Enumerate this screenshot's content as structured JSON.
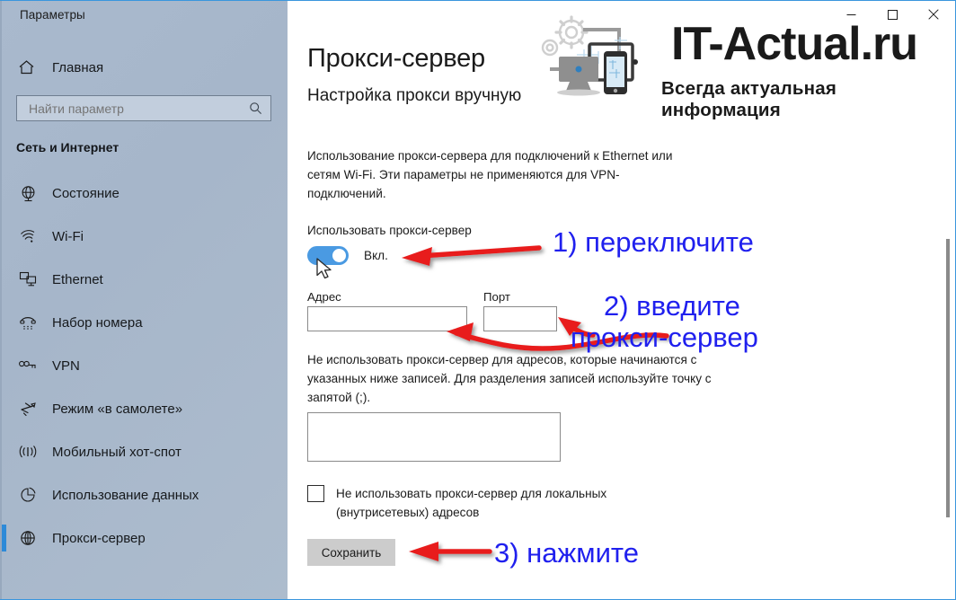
{
  "window": {
    "title": "Параметры",
    "controls": [
      {
        "name": "minimize",
        "glyph": "minimize-icon"
      },
      {
        "name": "maximize",
        "glyph": "maximize-icon"
      },
      {
        "name": "close",
        "glyph": "close-icon"
      }
    ],
    "accent_color": "#0078d7",
    "border_color": "#3a96dd"
  },
  "sidebar": {
    "background_color": "#a8b8cc",
    "home": {
      "label": "Главная",
      "icon": "home-icon"
    },
    "search": {
      "placeholder": "Найти параметр",
      "value": "",
      "icon": "search-icon"
    },
    "section_header": "Сеть и Интернет",
    "items": [
      {
        "label": "Состояние",
        "icon": "globe-status-icon",
        "selected": false
      },
      {
        "label": "Wi-Fi",
        "icon": "wifi-icon",
        "selected": false
      },
      {
        "label": "Ethernet",
        "icon": "ethernet-icon",
        "selected": false
      },
      {
        "label": "Набор номера",
        "icon": "dialup-phone-icon",
        "selected": false
      },
      {
        "label": "VPN",
        "icon": "vpn-key-icon",
        "selected": false
      },
      {
        "label": "Режим «в самолете»",
        "icon": "airplane-icon",
        "selected": false
      },
      {
        "label": "Мобильный хот-спот",
        "icon": "hotspot-icon",
        "selected": false
      },
      {
        "label": "Использование данных",
        "icon": "data-usage-pie-icon",
        "selected": false
      },
      {
        "label": "Прокси-сервер",
        "icon": "globe-proxy-icon",
        "selected": true
      }
    ]
  },
  "main": {
    "page_title": "Прокси-сервер",
    "subsection_title": "Настройка прокси вручную",
    "description": "Использование прокси-сервера для подключений к Ethernet или сетям Wi-Fi. Эти параметры не применяются для VPN-подключений.",
    "toggle": {
      "label": "Использовать прокси-сервер",
      "state_label": "Вкл.",
      "on": true,
      "on_color": "#4a9ae2"
    },
    "address_field": {
      "label": "Адрес",
      "value": "",
      "placeholder": ""
    },
    "port_field": {
      "label": "Порт",
      "value": "",
      "placeholder": ""
    },
    "exclusion_description": "Не использовать прокси-сервер для адресов, которые начинаются с указанных ниже записей. Для разделения записей используйте точку с запятой (;).",
    "exclusion_textarea": {
      "value": "",
      "placeholder": ""
    },
    "local_checkbox": {
      "label": "Не использовать прокси-сервер для локальных (внутрисетевых) адресов",
      "checked": false
    },
    "save_button": "Сохранить"
  },
  "annotations": {
    "color": "#2020ee",
    "arrow_color": "#e81c1c",
    "step1": "1) переключите",
    "step2_line1": "2) введите",
    "step2_line2": "прокси-сервер",
    "step3": "3) нажмите"
  },
  "watermark": {
    "title": "IT-Actual.ru",
    "tagline": "Всегда актуальная информация"
  }
}
